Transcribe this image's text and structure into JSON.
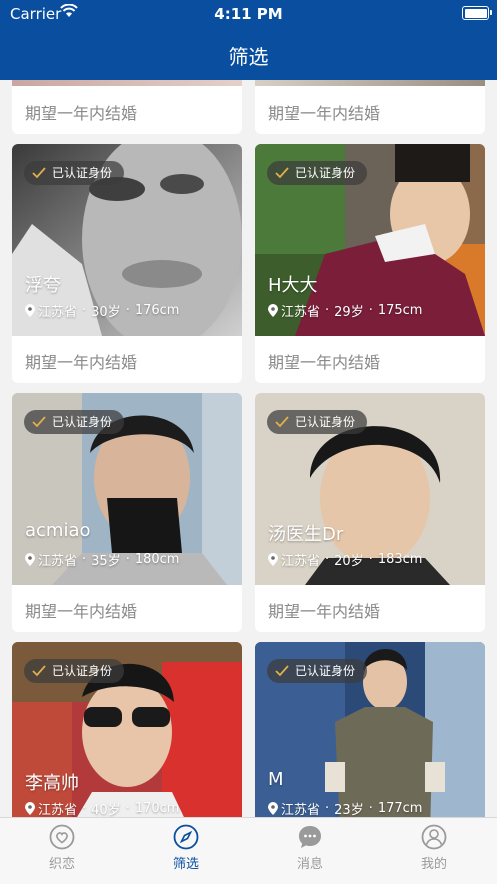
{
  "status_bar": {
    "carrier": "Carrier",
    "time": "4:11 PM"
  },
  "navbar": {
    "title": "筛选"
  },
  "badge_label": "已认证身份",
  "top_partial_cards": [
    {
      "wish": "期望一年内结婚"
    },
    {
      "wish": "期望一年内结婚"
    }
  ],
  "profiles": [
    {
      "name": "浮夸",
      "province": "江苏省",
      "age": "30岁",
      "height": "176cm",
      "wish": "期望一年内结婚",
      "verified": true
    },
    {
      "name": "H大大",
      "province": "江苏省",
      "age": "29岁",
      "height": "175cm",
      "wish": "期望一年内结婚",
      "verified": true
    },
    {
      "name": "acmiao",
      "province": "江苏省",
      "age": "35岁",
      "height": "180cm",
      "wish": "期望一年内结婚",
      "verified": true
    },
    {
      "name": "汤医生Dr",
      "province": "江苏省",
      "age": "20岁",
      "height": "183cm",
      "wish": "期望一年内结婚",
      "verified": true
    },
    {
      "name": "李高帅",
      "province": "江苏省",
      "age": "40岁",
      "height": "170cm",
      "wish": "",
      "verified": true
    },
    {
      "name": "M",
      "province": "江苏省",
      "age": "23岁",
      "height": "177cm",
      "wish": "",
      "verified": true
    }
  ],
  "tabs": [
    {
      "label": "织恋",
      "icon": "heart-icon",
      "active": false
    },
    {
      "label": "筛选",
      "icon": "compass-icon",
      "active": true
    },
    {
      "label": "消息",
      "icon": "chat-icon",
      "active": false
    },
    {
      "label": "我的",
      "icon": "user-icon",
      "active": false
    }
  ],
  "colors": {
    "primary": "#0a4ea0",
    "badge_check": "#e0b04a",
    "muted_text": "#8a8a8a",
    "tab_inactive": "#9a9a9a"
  }
}
